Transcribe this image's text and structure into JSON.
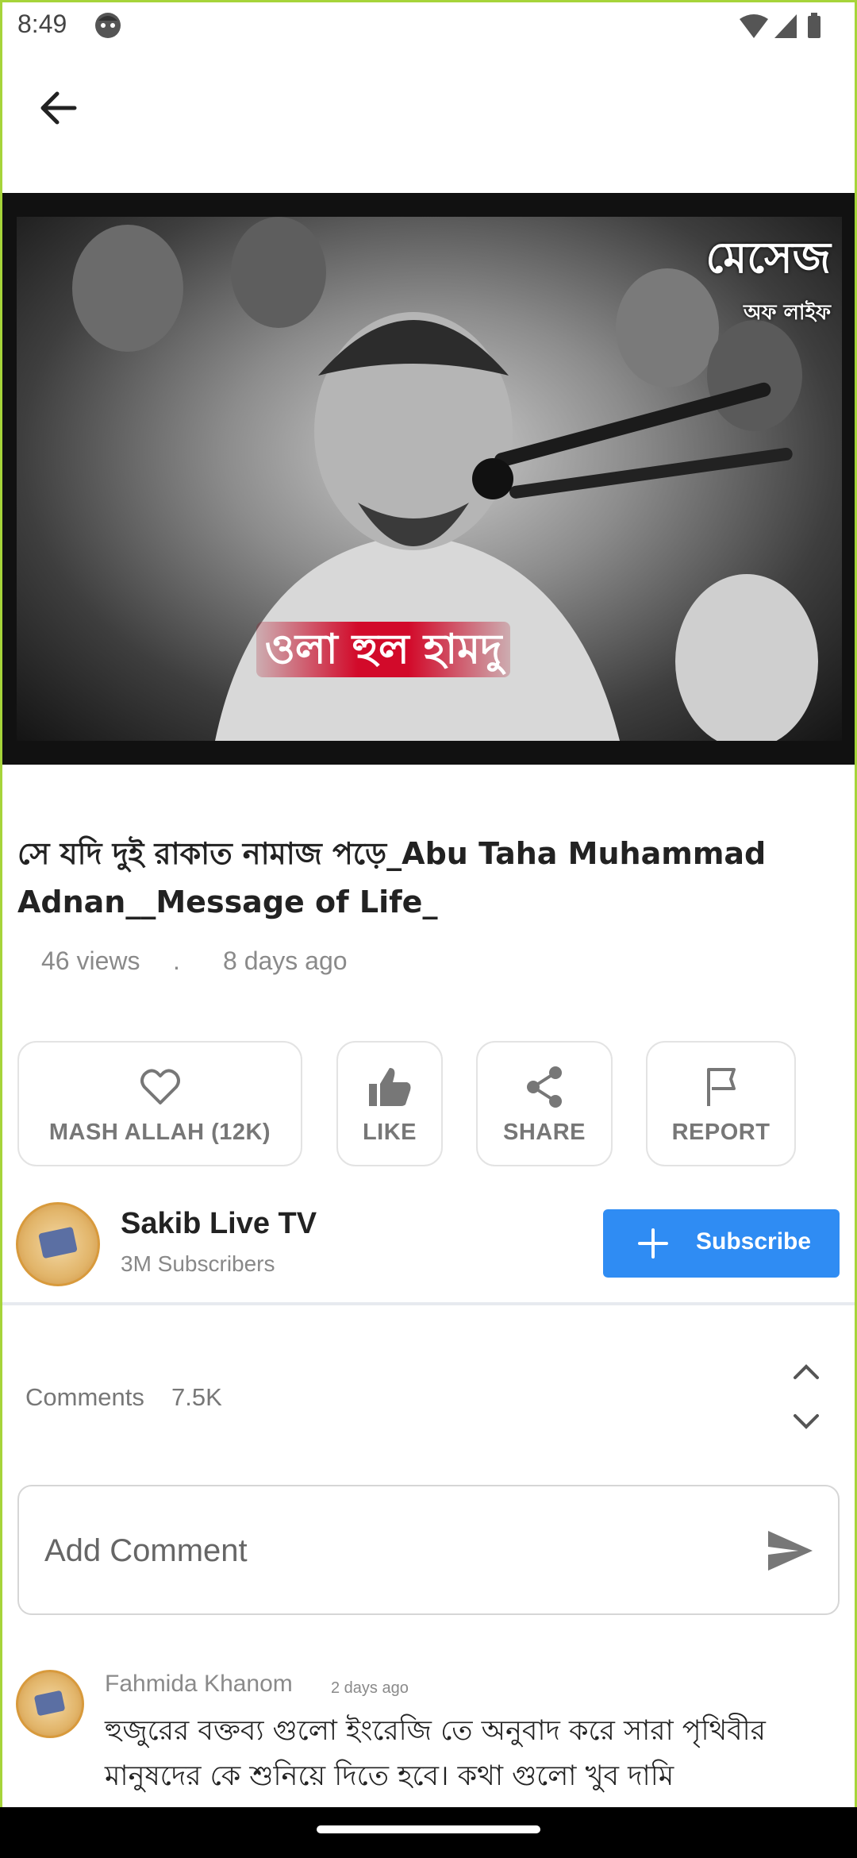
{
  "status_bar": {
    "time": "8:49",
    "icons": [
      "face-notification-icon",
      "wifi-icon",
      "signal-icon",
      "battery-icon"
    ]
  },
  "app_bar": {
    "back_icon": "arrow-back-icon"
  },
  "video": {
    "thumbnail_text_top": "মেসেজ",
    "thumbnail_text_top_small": "অফ লাইফ",
    "thumbnail_banner_text": "ওলা হুল হামদু",
    "title": "সে যদি দুই রাকাত নামাজ পড়ে_Abu Taha Muhammad Adnan__Message of Life_",
    "views": "46 views",
    "separator": ".",
    "age": "8 days ago"
  },
  "actions": [
    {
      "label": "MASH ALLAH (12K)",
      "icon": "heart-outline-icon"
    },
    {
      "label": "LIKE",
      "icon": "thumbs-up-icon"
    },
    {
      "label": "SHARE",
      "icon": "share-icon"
    },
    {
      "label": "REPORT",
      "icon": "flag-icon"
    }
  ],
  "channel": {
    "name": "Sakib Live TV",
    "subscribers": "3M Subscribers",
    "subscribe_label": "Subscribe",
    "subscribe_color": "#2f8cf3"
  },
  "comments": {
    "label": "Comments",
    "count": "7.5K",
    "input_placeholder": "Add Comment",
    "items": [
      {
        "author": "Fahmida Khanom",
        "time": "2 days ago",
        "text": "হুজুরের বক্তব্য গুলো ইংরেজি তে অনুবাদ করে সারা পৃথিবীর মানুষদের কে শুনিয়ে দিতে হবে। কথা গুলো খুব দামি"
      }
    ]
  },
  "colors": {
    "frame_border": "#a6d43a",
    "accent_blue": "#2f8cf3",
    "banner_red": "#d20a2a"
  }
}
